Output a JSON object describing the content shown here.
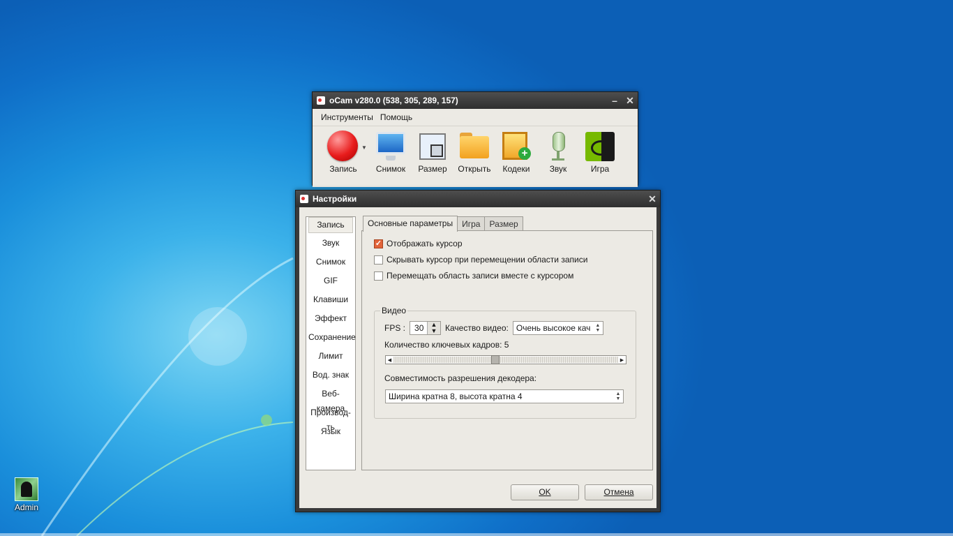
{
  "desktop": {
    "icon_label": "Admin"
  },
  "ocam": {
    "title": "oCam v280.0 (538, 305, 289, 157)",
    "menu": [
      "Инструменты",
      "Помощь"
    ],
    "tools": [
      {
        "label": "Запись",
        "icon": "record-icon"
      },
      {
        "label": "Снимок",
        "icon": "monitor-icon"
      },
      {
        "label": "Размер",
        "icon": "resize-icon"
      },
      {
        "label": "Открыть",
        "icon": "folder-icon"
      },
      {
        "label": "Кодеки",
        "icon": "codecs-icon"
      },
      {
        "label": "Звук",
        "icon": "microphone-icon"
      },
      {
        "label": "Игра",
        "icon": "nvidia-game-icon"
      }
    ],
    "record_color": "#e81c1c"
  },
  "settings": {
    "title": "Настройки",
    "sidebar": [
      "Запись",
      "Звук",
      "Снимок",
      "GIF",
      "Клавиши",
      "Эффект",
      "Сохранение",
      "Лимит",
      "Вод. знак",
      "Веб-камера",
      "Производ-ть",
      "Язык"
    ],
    "selected_sidebar": "Запись",
    "tabs": [
      "Основные параметры",
      "Игра",
      "Размер"
    ],
    "active_tab": "Основные параметры",
    "checkboxes": [
      {
        "label": "Отображать курсор",
        "checked": true
      },
      {
        "label": "Скрывать курсор при перемещении области записи",
        "checked": false
      },
      {
        "label": "Перемещать область записи вместе с курсором",
        "checked": false
      }
    ],
    "video": {
      "group_title": "Видео",
      "fps_label": "FPS :",
      "fps_value": "30",
      "quality_label": "Качество видео:",
      "quality_value": "Очень высокое кач",
      "keyframes_label": "Количество ключевых кадров: 5",
      "keyframes_slider_fraction": 0.45,
      "decoder_label": "Совместимость разрешения декодера:",
      "decoder_value": "Ширина кратна 8, высота кратна 4"
    },
    "ok_label": "OK",
    "cancel_label": "Отмена",
    "accent_color": "#e2643a"
  }
}
